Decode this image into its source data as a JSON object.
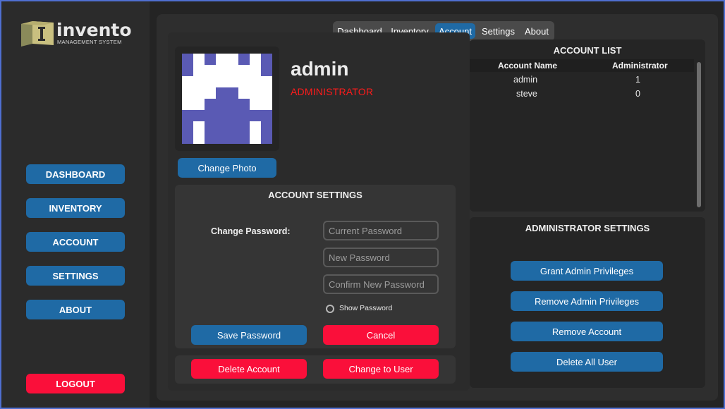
{
  "logo": {
    "word": "invento",
    "subtitle": "MANAGEMENT SYSTEM"
  },
  "sidebar": {
    "items": [
      {
        "label": "DASHBOARD"
      },
      {
        "label": "INVENTORY"
      },
      {
        "label": "ACCOUNT"
      },
      {
        "label": "SETTINGS"
      },
      {
        "label": "ABOUT"
      }
    ],
    "logout_label": "LOGOUT"
  },
  "tabs": [
    {
      "label": "Dashboard",
      "active": false
    },
    {
      "label": "Inventory",
      "active": false
    },
    {
      "label": "Account",
      "active": true
    },
    {
      "label": "Settings",
      "active": false
    },
    {
      "label": "About",
      "active": false
    }
  ],
  "profile": {
    "username": "admin",
    "role": "ADMINISTRATOR",
    "change_photo_label": "Change Photo"
  },
  "account_settings": {
    "title": "ACCOUNT SETTINGS",
    "change_password_label": "Change Password:",
    "current_password_placeholder": "Current Password",
    "new_password_placeholder": "New Password",
    "confirm_password_placeholder": "Confirm New Password",
    "show_password_label": "Show Password",
    "save_label": "Save Password",
    "cancel_label": "Cancel"
  },
  "account_actions": {
    "delete_label": "Delete Account",
    "change_to_user_label": "Change to User"
  },
  "account_list": {
    "title": "ACCOUNT LIST",
    "columns": [
      "Account Name",
      "Administrator"
    ],
    "rows": [
      {
        "name": "admin",
        "admin": "1"
      },
      {
        "name": "steve",
        "admin": "0"
      }
    ]
  },
  "admin_settings": {
    "title": "ADMINISTRATOR SETTINGS",
    "grant_label": "Grant Admin Privileges",
    "remove_privileges_label": "Remove Admin Privileges",
    "remove_account_label": "Remove Account",
    "delete_all_label": "Delete All User"
  },
  "colors": {
    "accent_blue": "#1f6aa5",
    "danger_red": "#fa0f3a",
    "role_red": "#ff1b1b",
    "avatar_purple": "#5a5ab4"
  },
  "icons": {
    "logo_icon": "box-logo-icon",
    "avatar": "pixel-identicon"
  }
}
